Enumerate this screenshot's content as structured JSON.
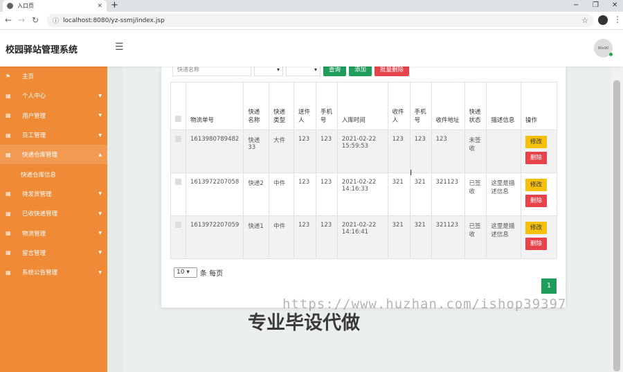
{
  "browser": {
    "tab_title": "入口页",
    "url": "localhost:8080/yz-ssmj/index.jsp",
    "new_tab": "+",
    "minimize": "−",
    "restore": "❐",
    "close": "✕"
  },
  "header": {
    "brand": "校园驿站管理系统",
    "avatar_text": "90x90"
  },
  "sidebar": {
    "items": [
      {
        "label": "主页"
      },
      {
        "label": "个人中心"
      },
      {
        "label": "用户管理"
      },
      {
        "label": "员工管理"
      },
      {
        "label": "快递仓库管理"
      },
      {
        "label": "快递仓库信息"
      },
      {
        "label": "待发货管理"
      },
      {
        "label": "已收快递管理"
      },
      {
        "label": "物流管理"
      },
      {
        "label": "留言管理"
      },
      {
        "label": "系统公告管理"
      }
    ]
  },
  "toolbar": {
    "search_placeholder": "快递名称",
    "query": "查询",
    "add": "添加",
    "batch_delete": "批量删除"
  },
  "table": {
    "headers": [
      "物流单号",
      "快递名称",
      "快递类型",
      "送件人",
      "手机号",
      "入库时间",
      "收件人",
      "手机号",
      "收件地址",
      "快递状态",
      "描述信息",
      "操作"
    ],
    "rows": [
      {
        "tracking": "1613980789482",
        "name": "快递33",
        "type": "大件",
        "sender": "123",
        "sender_phone": "123",
        "time": "2021-02-22 15:59:53",
        "receiver": "123",
        "receiver_phone": "123",
        "address": "123",
        "status": "未签收",
        "desc": ""
      },
      {
        "tracking": "1613972207058",
        "name": "快递2",
        "type": "中件",
        "sender": "123",
        "sender_phone": "123",
        "time": "2021-02-22 14:16:33",
        "receiver": "321",
        "receiver_phone": "321",
        "address": "321123",
        "status": "已签收",
        "desc": "这里是描述信息"
      },
      {
        "tracking": "1613972207059",
        "name": "快递1",
        "type": "中件",
        "sender": "123",
        "sender_phone": "123",
        "time": "2021-02-22 14:16:41",
        "receiver": "321",
        "receiver_phone": "321",
        "address": "321123",
        "status": "已签收",
        "desc": "这里是描述信息"
      }
    ],
    "edit_label": "修改",
    "delete_label": "删除"
  },
  "pager": {
    "page_size": "10",
    "per_page_label": "条 每页",
    "current_page": "1"
  },
  "watermark": {
    "url": "https://www.huzhan.com/ishop39397",
    "text": "专业毕设代做"
  }
}
